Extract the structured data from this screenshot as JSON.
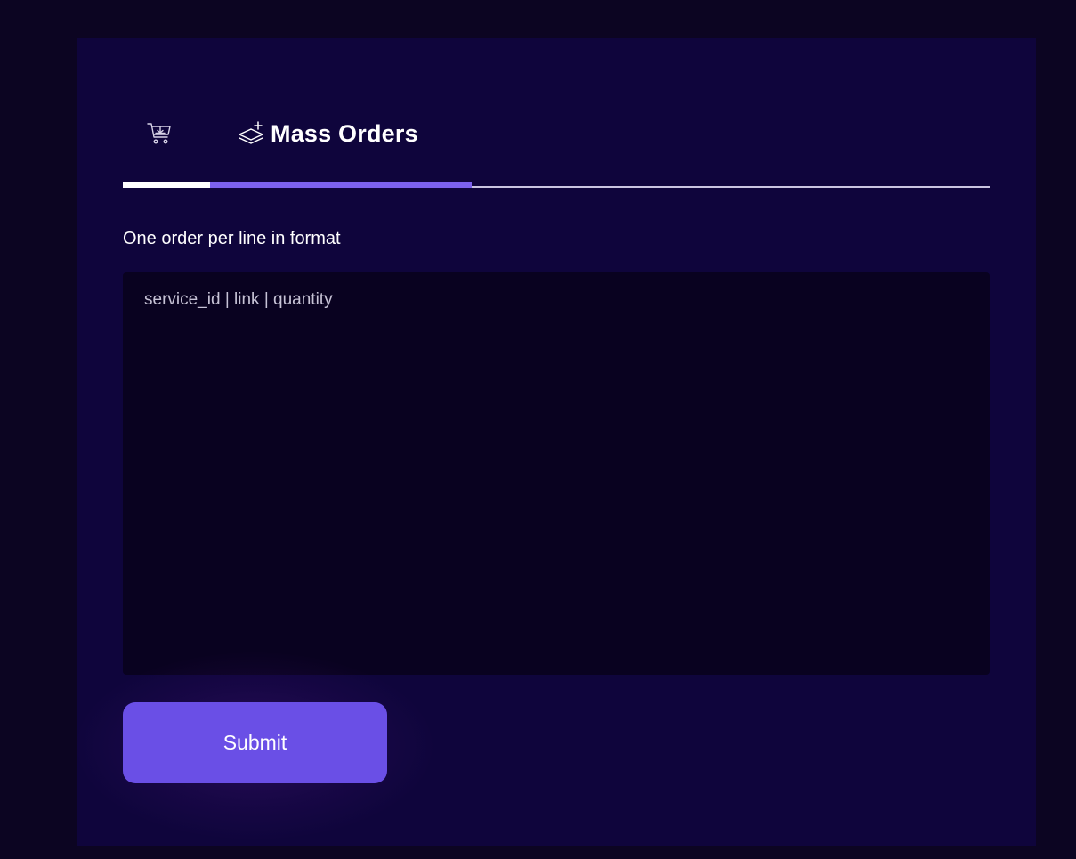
{
  "tabs": [
    {
      "icon": "cart-download-icon",
      "label": ""
    },
    {
      "icon": "layers-plus-icon",
      "label": "Mass Orders",
      "active": true
    }
  ],
  "form": {
    "instruction": "One order per line in format",
    "textarea_placeholder": "service_id | link | quantity",
    "textarea_value": "",
    "submit_label": "Submit"
  },
  "colors": {
    "background": "#0c0522",
    "panel": "#0f053c",
    "textarea_bg": "#090220",
    "accent": "#6a4fe6",
    "tab_indicator": "#7c62ee"
  }
}
